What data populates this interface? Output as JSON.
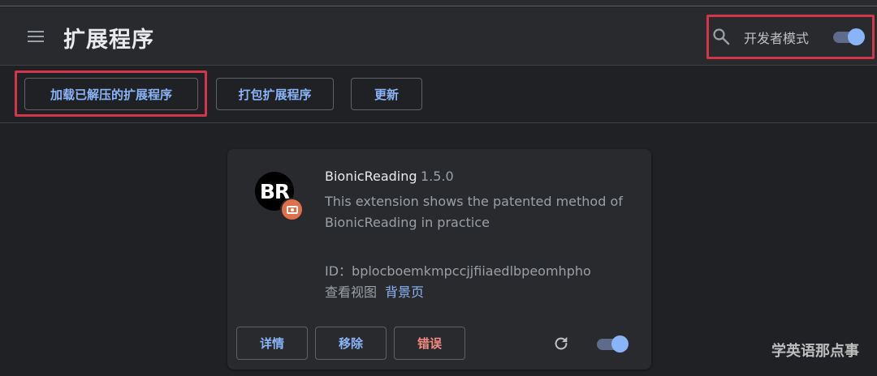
{
  "header": {
    "title": "扩展程序",
    "menu_icon": "hamburger-menu-icon",
    "search_icon": "search-icon",
    "developer_mode_label": "开发者模式",
    "developer_mode_on": true
  },
  "toolbar": {
    "load_unpacked_label": "加载已解压的扩展程序",
    "pack_extension_label": "打包扩展程序",
    "update_label": "更新"
  },
  "extension": {
    "logo_text": "BR",
    "name": "BionicReading",
    "version": "1.5.0",
    "description": "This extension shows the patented method of BionicReading in practice",
    "id_text": "ID：bplocboemkmpccjjfiiaedlbpeomhpho",
    "inspect_views_label": "查看视图",
    "background_page_link": "背景页",
    "details_label": "详情",
    "remove_label": "移除",
    "errors_label": "错误",
    "enabled": true,
    "reload_icon": "reload-icon"
  },
  "watermark": "学英语那点事",
  "colors": {
    "accent": "#8ab4f8",
    "error": "#f28b82",
    "highlight": "#d3364a",
    "badge": "#e0704a"
  }
}
